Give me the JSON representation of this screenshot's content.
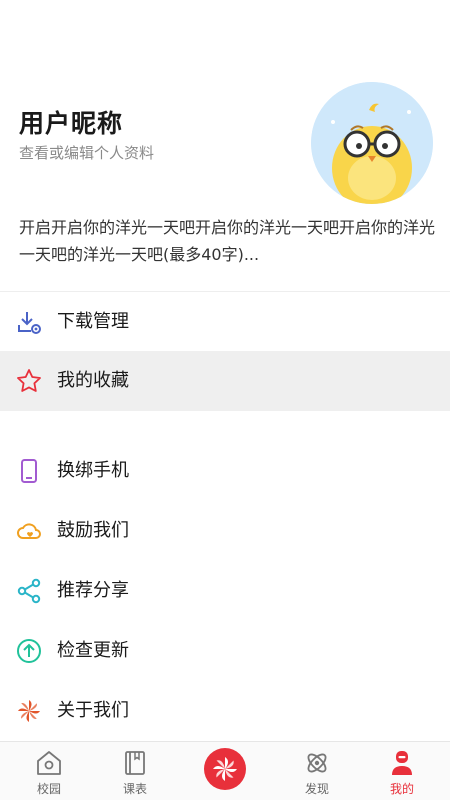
{
  "profile": {
    "nickname": "用户昵称",
    "subtitle": "查看或编辑个人资料",
    "signature": "开启开启你的洋光一天吧开启你的洋光一天吧开启你的洋光一天吧的洋光一天吧(最多40字)..."
  },
  "menu": {
    "items": [
      {
        "label": "下载管理",
        "icon": "download-manage-icon",
        "color": "#4a63c7"
      },
      {
        "label": "我的收藏",
        "icon": "star-icon",
        "color": "#e8303b"
      },
      {
        "label": "换绑手机",
        "icon": "phone-icon",
        "color": "#a25bd1"
      },
      {
        "label": "鼓励我们",
        "icon": "cloud-heart-icon",
        "color": "#f0a020"
      },
      {
        "label": "推荐分享",
        "icon": "share-icon",
        "color": "#2bb5c8"
      },
      {
        "label": "检查更新",
        "icon": "upload-circle-icon",
        "color": "#21c29a"
      },
      {
        "label": "关于我们",
        "icon": "pinwheel-icon",
        "color": "#e2552a"
      }
    ]
  },
  "tabbar": {
    "tabs": [
      {
        "label": "校园",
        "icon": "campus-icon"
      },
      {
        "label": "课表",
        "icon": "schedule-icon"
      },
      {
        "label": "",
        "icon": "pinwheel-center-icon"
      },
      {
        "label": "发现",
        "icon": "discover-icon"
      },
      {
        "label": "我的",
        "icon": "profile-icon"
      }
    ],
    "active_color": "#e8303b"
  }
}
